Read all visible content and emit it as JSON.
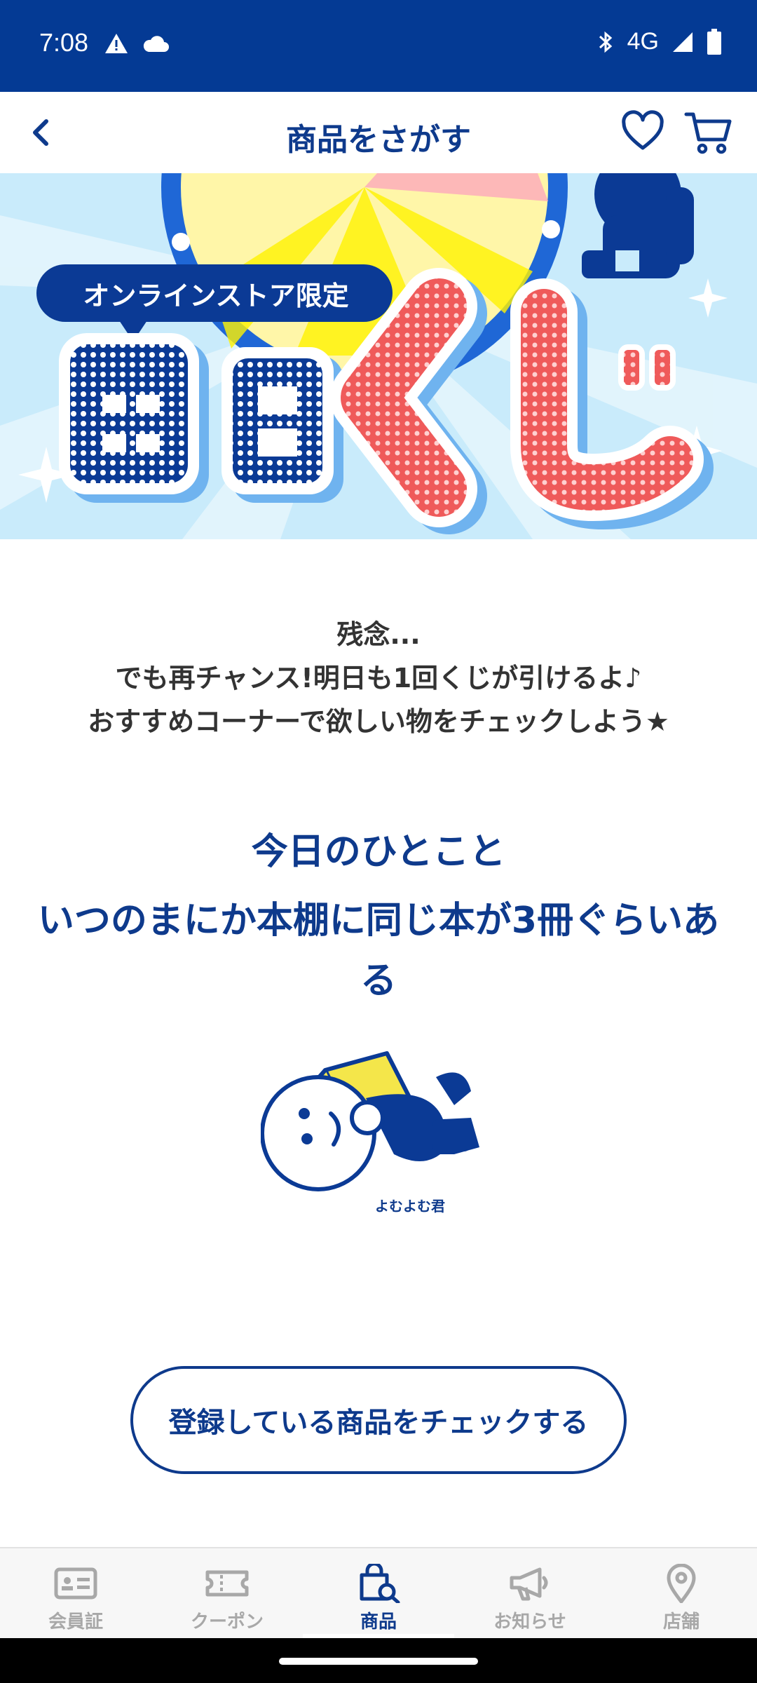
{
  "status_bar": {
    "time": "7:08",
    "network": "4G",
    "icons": [
      "alert-icon",
      "cloud-icon",
      "bluetooth-icon",
      "signal-icon",
      "battery-icon"
    ]
  },
  "header": {
    "title": "商品をさがす",
    "icons": [
      "back-arrow-icon",
      "heart-icon",
      "cart-icon"
    ]
  },
  "banner": {
    "pill_text": "オンラインストア限定",
    "title_chars": [
      "毎",
      "日",
      "く",
      "じ"
    ]
  },
  "result": {
    "lines": [
      "残念...",
      "でも再チャンス!明日も1回くじが引けるよ♪",
      "おすすめコーナーで欲しい物をチェックしよう★"
    ]
  },
  "daily": {
    "title": "今日のひとこと",
    "text": "いつのまにか本棚に同じ本が3冊ぐらいある"
  },
  "mascot": {
    "caption": "よむよむ君"
  },
  "cta": {
    "label": "登録している商品をチェックする"
  },
  "bottom_nav": {
    "items": [
      {
        "label": "会員証",
        "icon": "member-card-icon",
        "active": false
      },
      {
        "label": "クーポン",
        "icon": "coupon-icon",
        "active": false
      },
      {
        "label": "商品",
        "icon": "shopping-bag-search-icon",
        "active": true
      },
      {
        "label": "お知らせ",
        "icon": "megaphone-icon",
        "active": false
      },
      {
        "label": "店舗",
        "icon": "location-pin-icon",
        "active": false
      }
    ]
  },
  "colors": {
    "brand_navy": "#043a94",
    "text_navy": "#0e3a8c",
    "banner_bg": "#bfe3f7",
    "accent_red": "#ef5a5a"
  }
}
